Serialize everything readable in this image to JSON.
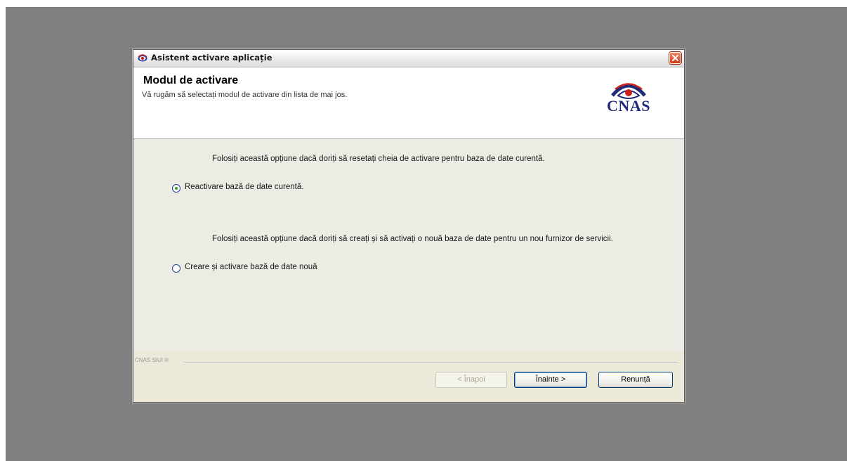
{
  "window": {
    "title": "Asistent activare aplicație"
  },
  "header": {
    "title": "Modul de activare",
    "subtitle": "Vă rugăm să selectați modul de activare din lista de mai jos.",
    "logo_text": "CNAS"
  },
  "options": [
    {
      "label": "Reactivare bază de date curentă.",
      "description": "Folosiți această opțiune dacă doriți să resetați cheia de activare pentru baza de date curentă.",
      "checked": true
    },
    {
      "label": "Creare și activare bază de date nouă",
      "description": "Folosiți această opțiune dacă doriți să creați și să activați o nouă baza de date pentru un nou furnizor de servicii.",
      "checked": false
    }
  ],
  "footer": {
    "brand": "CNAS SIUI ®",
    "back_label": "< Înapoi",
    "next_label": "Înainte >",
    "cancel_label": "Renunță"
  },
  "colors": {
    "desktop": "#808080",
    "dialog": "#ece9d8",
    "logo": "#1f2a7a"
  }
}
